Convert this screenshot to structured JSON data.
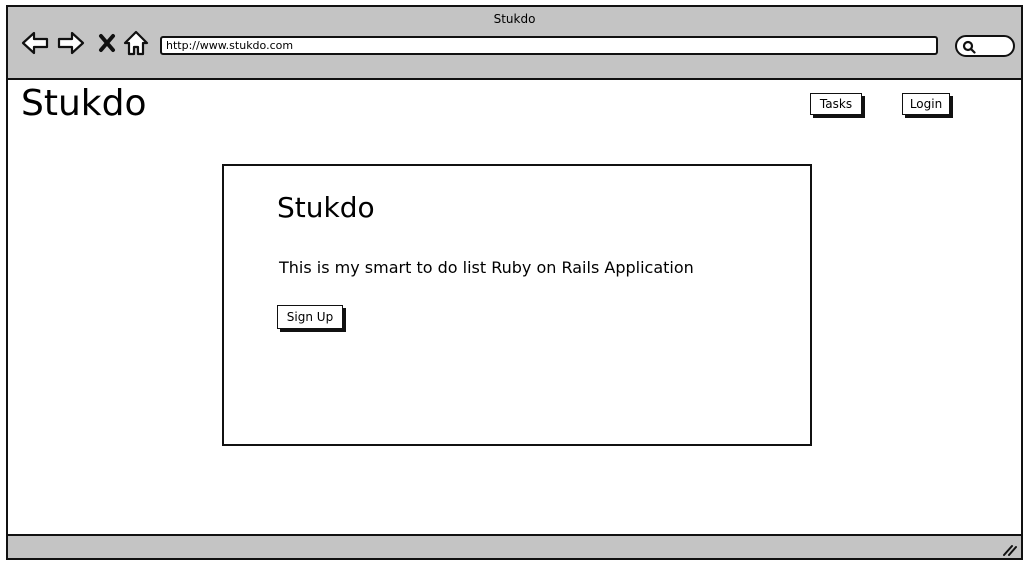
{
  "window": {
    "title": "Stukdo"
  },
  "toolbar": {
    "address": "http://www.stukdo.com",
    "icons": [
      "back-arrow-icon",
      "forward-arrow-icon",
      "close-icon",
      "home-icon",
      "search-icon"
    ]
  },
  "header": {
    "logo": "Stukdo",
    "nav": {
      "tasks_label": "Tasks",
      "login_label": "Login"
    }
  },
  "main": {
    "title": "Stukdo",
    "description": "This is my smart to do list Ruby on Rails Application",
    "signup_label": "Sign Up"
  },
  "colors": {
    "chrome": "#c4c4c4",
    "stroke": "#111111",
    "background": "#ffffff"
  }
}
